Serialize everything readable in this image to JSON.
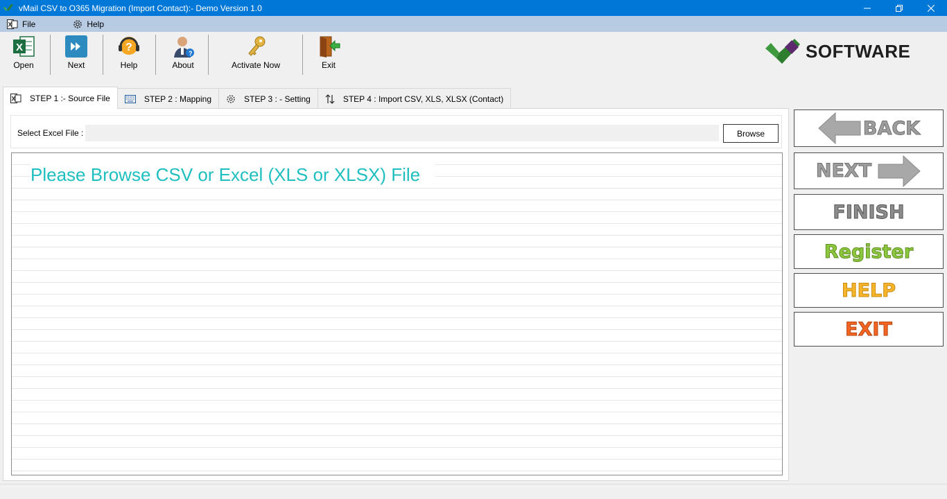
{
  "window": {
    "title": "vMail CSV to O365 Migration (Import Contact):- Demo Version 1.0"
  },
  "menu": {
    "file": "File",
    "help": "Help"
  },
  "toolbar": {
    "open": "Open",
    "next": "Next",
    "help": "Help",
    "about": "About",
    "activate": "Activate Now",
    "exit": "Exit"
  },
  "brand": {
    "logo_text": "SOFTWARE"
  },
  "tabs": [
    {
      "label": "STEP 1 :- Source File",
      "active": true
    },
    {
      "label": "STEP 2 : Mapping",
      "active": false
    },
    {
      "label": "STEP 3 : - Setting",
      "active": false
    },
    {
      "label": "STEP 4 : Import CSV, XLS, XLSX (Contact)",
      "active": false
    }
  ],
  "source": {
    "select_label": "Select Excel File :",
    "file_value": "",
    "browse": "Browse",
    "message": "Please Browse CSV or Excel (XLS or XLSX) File"
  },
  "actions": {
    "back": "BACK",
    "next": "NEXT",
    "finish": "FINISH",
    "register": "Register",
    "help": "HELP",
    "exit": "EXIT"
  },
  "colors": {
    "titlebar": "#0078d7",
    "menubar": "#b7cbe2",
    "message": "#1fbfbf",
    "register": "#8dc63f",
    "help": "#f7b52c",
    "exit": "#f26522"
  }
}
